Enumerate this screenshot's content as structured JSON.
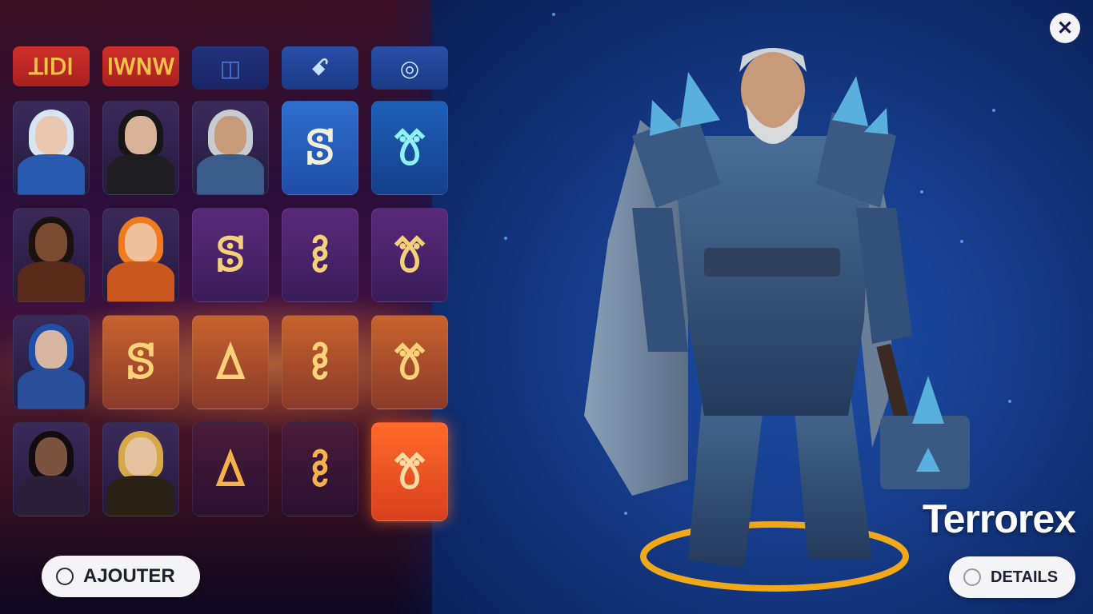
{
  "tabs": [
    {
      "label": "ꓕꓲꓓꓲ",
      "style": "red"
    },
    {
      "label": "ꓲꓪꓠꓪ",
      "style": "red"
    },
    {
      "label": "◫",
      "style": "blue dark"
    },
    {
      "label": "ꗃ",
      "style": "blue"
    },
    {
      "label": "◎",
      "style": "blue"
    }
  ],
  "grid": [
    [
      {
        "type": "portrait",
        "name": "ice-sorceress",
        "hair": "#d8e4f2",
        "skin": "#e9c6b0",
        "outfit": "#2a5ab0"
      },
      {
        "type": "portrait",
        "name": "dark-rogue",
        "hair": "#161616",
        "skin": "#d8b39a",
        "outfit": "#1e1e22"
      },
      {
        "type": "portrait",
        "name": "frost-warrior",
        "hair": "#c8cbcf",
        "skin": "#c79a7a",
        "outfit": "#3b5c8a"
      },
      {
        "type": "glyph",
        "glyph": "ꕷ",
        "style": "blue"
      },
      {
        "type": "glyph",
        "glyph": "ꔢ",
        "style": "cyan"
      }
    ],
    [
      {
        "type": "portrait",
        "name": "lava-brute",
        "hair": "#1a120e",
        "skin": "#7a4a32",
        "outfit": "#5a2a1a"
      },
      {
        "type": "portrait",
        "name": "flame-maiden",
        "hair": "#f07a1e",
        "skin": "#f0c09a",
        "outfit": "#c8561e"
      },
      {
        "type": "glyph",
        "glyph": "ꕷ",
        "style": "violet"
      },
      {
        "type": "glyph",
        "glyph": "ꔧ",
        "style": "violet"
      },
      {
        "type": "glyph",
        "glyph": "ꔢ",
        "style": "violet"
      }
    ],
    [
      {
        "type": "portrait",
        "name": "azure-knight",
        "hair": "#1f4fa8",
        "skin": "#d7b7a2",
        "outfit": "#2a4f9a"
      },
      {
        "type": "glyph",
        "glyph": "ꕷ",
        "style": "orange"
      },
      {
        "type": "glyph",
        "glyph": "ꕔ",
        "style": "orange"
      },
      {
        "type": "glyph",
        "glyph": "ꔧ",
        "style": "orange"
      },
      {
        "type": "glyph",
        "glyph": "ꔢ",
        "style": "orange"
      }
    ],
    [
      {
        "type": "portrait",
        "name": "shadow-queen",
        "hair": "#120c10",
        "skin": "#7a5240",
        "outfit": "#2c1f3a"
      },
      {
        "type": "portrait",
        "name": "golden-scout",
        "hair": "#d7a84a",
        "skin": "#e4c3a0",
        "outfit": "#2a2214"
      },
      {
        "type": "glyph",
        "glyph": "ꕔ",
        "style": "dusk"
      },
      {
        "type": "glyph",
        "glyph": "ꔧ",
        "style": "dusk"
      },
      {
        "type": "glyph",
        "glyph": "ꔢ",
        "style": "hot"
      }
    ]
  ],
  "buttons": {
    "add_label": "AJOUTER",
    "details_label": "DETAILS",
    "close_glyph": "✕"
  },
  "character": {
    "name": "Terrorex"
  },
  "colors": {
    "ring": "#f0a818",
    "armor": "#3e5f86",
    "crystal": "#4ea0d8"
  }
}
